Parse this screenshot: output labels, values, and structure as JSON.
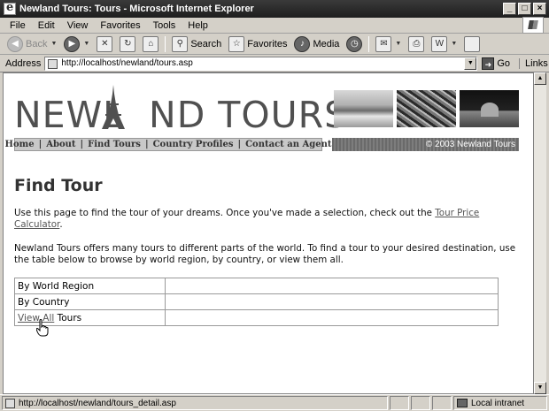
{
  "window": {
    "title": "Newland Tours: Tours - Microsoft Internet Explorer",
    "controls": [
      "_",
      "□",
      "×"
    ]
  },
  "menubar": {
    "items": [
      "File",
      "Edit",
      "View",
      "Favorites",
      "Tools",
      "Help"
    ]
  },
  "toolbar": {
    "back_label": "Back",
    "search_label": "Search",
    "favorites_label": "Favorites",
    "media_label": "Media"
  },
  "addressbar": {
    "label": "Address",
    "url": "http://localhost/newland/tours.asp",
    "go_label": "Go",
    "links_label": "Links"
  },
  "page": {
    "logo_text": "NEWL  ND TOURS",
    "nav": [
      "Home",
      "About",
      "Find Tours",
      "Country Profiles",
      "Contact an Agent"
    ],
    "nav_separator": "|",
    "copyright": "© 2003 Newland Tours",
    "heading": "Find Tour",
    "para1_text": "Use this page to find the tour of your dreams. Once you've made a selection, check out the ",
    "para1_link": "Tour Price Calculator",
    "para1_end": ".",
    "para2_text": "Newland Tours offers many tours to different parts of the world. To find a tour to your desired destination, use the table below to browse by world region, by country, or view them all.",
    "table": {
      "row1": "By World Region",
      "row2": "By Country",
      "row3_link": "View All",
      "row3_rest": " Tours"
    }
  },
  "statusbar": {
    "text": "http://localhost/newland/tours_detail.asp",
    "zone": "Local intranet"
  }
}
